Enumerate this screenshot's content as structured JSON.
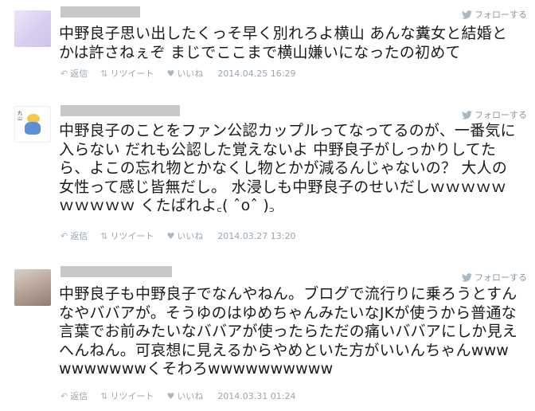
{
  "common": {
    "follow_label": "フォローする",
    "reply_label": "返信",
    "retweet_label": "リツイート",
    "like_label": "いいね",
    "colors": {
      "meta": "#99a7b2",
      "text": "#1a1a1a",
      "redact": "#c8c8c8"
    }
  },
  "tweets": [
    {
      "avatar": "lavender-avatar",
      "text": "中野良子思い出したくっそ早く別れろよ横山 あんな糞女と結婚とかは許さねぇぞ まじでここまで横山嫌いになったの初めて",
      "timestamp": "2014.04.25 16:29"
    },
    {
      "avatar": "illustration-avatar",
      "text": "中野良子のことをファン公認カップルってなってるのが、一番気に入らない だれも公認した覚えないよ 中野良子がしっかりしてたら、よこの忘れ物とかなくし物とかが減るんじゃないの？ 大人の女性って感じ皆無だし。 水浸しも中野良子のせいだしｗｗｗｗｗｗｗｗｗｗ くたばれよ꜀( ˆoˆ )꜆",
      "timestamp": "2014.03.27 13:20"
    },
    {
      "avatar": "photo-avatar",
      "text": "中野良子も中野良子でなんやねん。ブログで流行りに乗ろうとすんなやババアが。そうゆのはゆめちゃんみたいなJKが使うから普通な言葉でお前みたいなババアが使ったらただの痛いババアにしか見えへんねん。可哀想に見えるからやめといた方がいいんちゃんwwwwwwwwwwくそわろwwwwwwwwww",
      "timestamp": "2014.03.31 01:24"
    }
  ]
}
